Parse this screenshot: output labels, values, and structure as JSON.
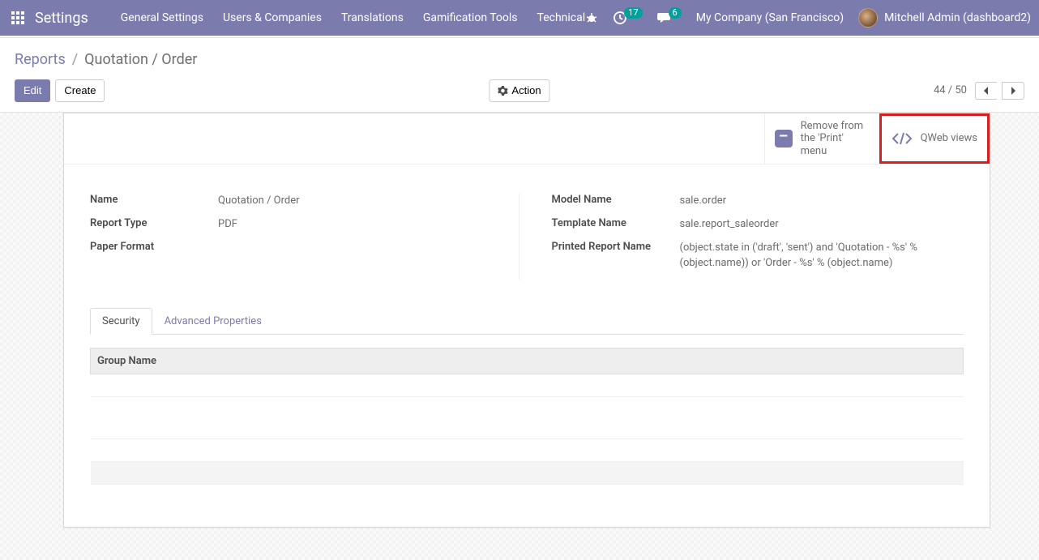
{
  "navbar": {
    "app_title": "Settings",
    "items": [
      "General Settings",
      "Users & Companies",
      "Translations",
      "Gamification Tools",
      "Technical"
    ],
    "activities_count": "17",
    "discuss_count": "6",
    "company": "My Company (San Francisco)",
    "user": "Mitchell Admin (dashboard2)"
  },
  "breadcrumb": {
    "root": "Reports",
    "current": "Quotation / Order"
  },
  "buttons": {
    "edit": "Edit",
    "create": "Create",
    "action": "Action"
  },
  "pager": {
    "text": "44 / 50"
  },
  "stat_buttons": {
    "print_menu_label": "Remove from the 'Print' menu",
    "qweb_label": "QWeb views"
  },
  "fields": {
    "left": [
      {
        "label": "Name",
        "value": "Quotation / Order"
      },
      {
        "label": "Report Type",
        "value": "PDF"
      },
      {
        "label": "Paper Format",
        "value": ""
      }
    ],
    "right": [
      {
        "label": "Model Name",
        "value": "sale.order"
      },
      {
        "label": "Template Name",
        "value": "sale.report_saleorder"
      },
      {
        "label": "Printed Report Name",
        "value": "(object.state in ('draft', 'sent') and 'Quotation - %s' % (object.name)) or 'Order - %s' % (object.name)"
      }
    ]
  },
  "tabs": {
    "security": "Security",
    "advanced": "Advanced Properties"
  },
  "table": {
    "header": "Group Name"
  }
}
